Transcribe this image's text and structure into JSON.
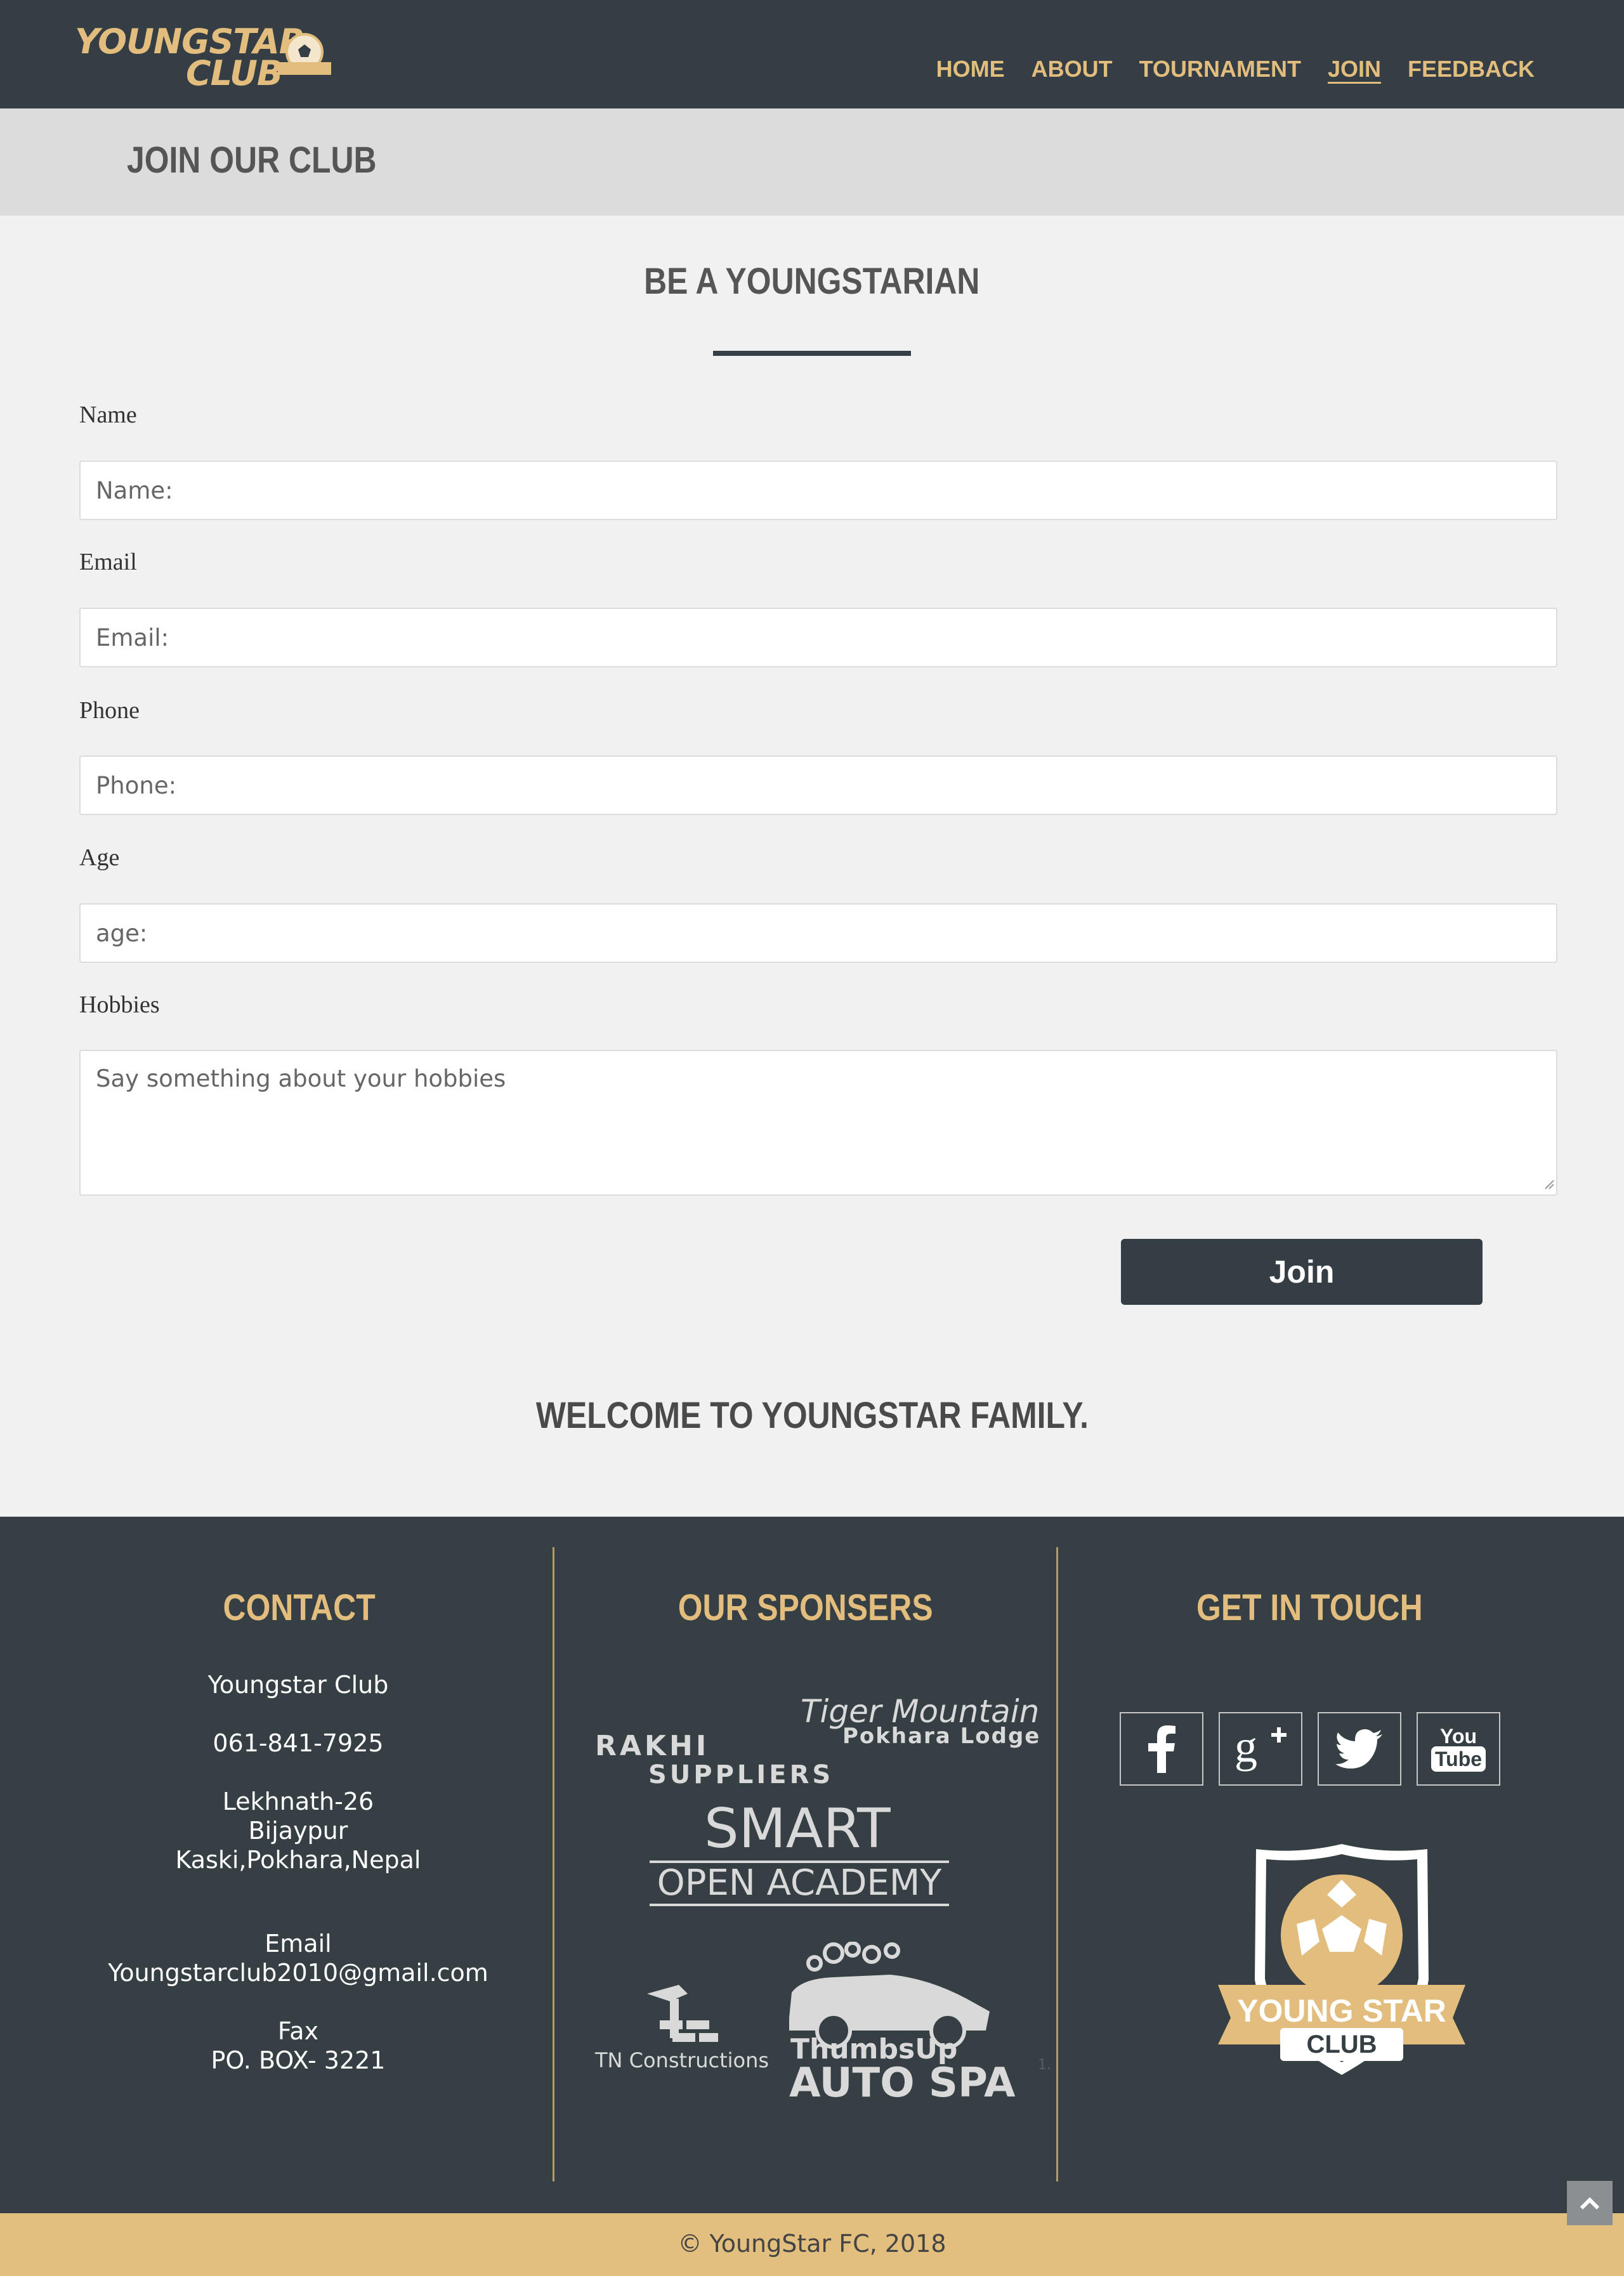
{
  "brand": {
    "line1": "YOUNGSTAR",
    "line2": "CLUB",
    "badge_text": "YOUNGSTAR CLUB"
  },
  "nav": {
    "items": [
      {
        "label": "HOME"
      },
      {
        "label": "ABOUT"
      },
      {
        "label": "TOURNAMENT"
      },
      {
        "label": "JOIN",
        "active": true
      },
      {
        "label": "FEEDBACK"
      }
    ]
  },
  "page": {
    "title": "JOIN OUR CLUB",
    "section_title": "BE A YOUNGSTARIAN",
    "welcome": "WELCOME TO YOUNGSTAR FAMILY."
  },
  "form": {
    "name": {
      "label": "Name",
      "placeholder": "Name:",
      "value": ""
    },
    "email": {
      "label": "Email",
      "placeholder": "Email:",
      "value": ""
    },
    "phone": {
      "label": "Phone",
      "placeholder": "Phone:",
      "value": ""
    },
    "age": {
      "label": "Age",
      "placeholder": "age:",
      "value": ""
    },
    "hobbies": {
      "label": "Hobbies",
      "placeholder": "Say something about your hobbies",
      "value": ""
    },
    "submit_label": "Join"
  },
  "footer": {
    "contact": {
      "title": "CONTACT",
      "org": "Youngstar Club",
      "phone": "061-841-7925",
      "address_line1": "Lekhnath-26",
      "address_line2": "Bijaypur",
      "address_line3": "Kaski,Pokhara,Nepal",
      "email_label": "Email",
      "email": "Youngstarclub2010@gmail.com",
      "fax_label": "Fax",
      "fax": "PO. BOX- 3221"
    },
    "sponsors": {
      "title": "OUR SPONSERS",
      "tiger_line1": "Tiger Mountain",
      "tiger_line2": "Pokhara Lodge",
      "rakhi_line1": "RAKHI",
      "rakhi_line2": "SUPPLIERS",
      "smart_line1": "SMART",
      "smart_line2": "OPEN ACADEMY",
      "tn": "TN Constructions",
      "thumbs_line1": "ThumbsUp",
      "thumbs_line2": "AUTO SPA",
      "marker": "1."
    },
    "touch": {
      "title": "GET IN TOUCH",
      "crest_line1": "YOUNG STAR",
      "crest_line2": "CLUB",
      "youtube_line1": "You",
      "youtube_line2": "Tube"
    }
  },
  "copyright": "© YoungStar FC, 2018",
  "colors": {
    "dark": "#343e44",
    "gold": "#e3bd7e",
    "light_bg": "#f1f1f1",
    "header_band": "#dcdcdc"
  }
}
